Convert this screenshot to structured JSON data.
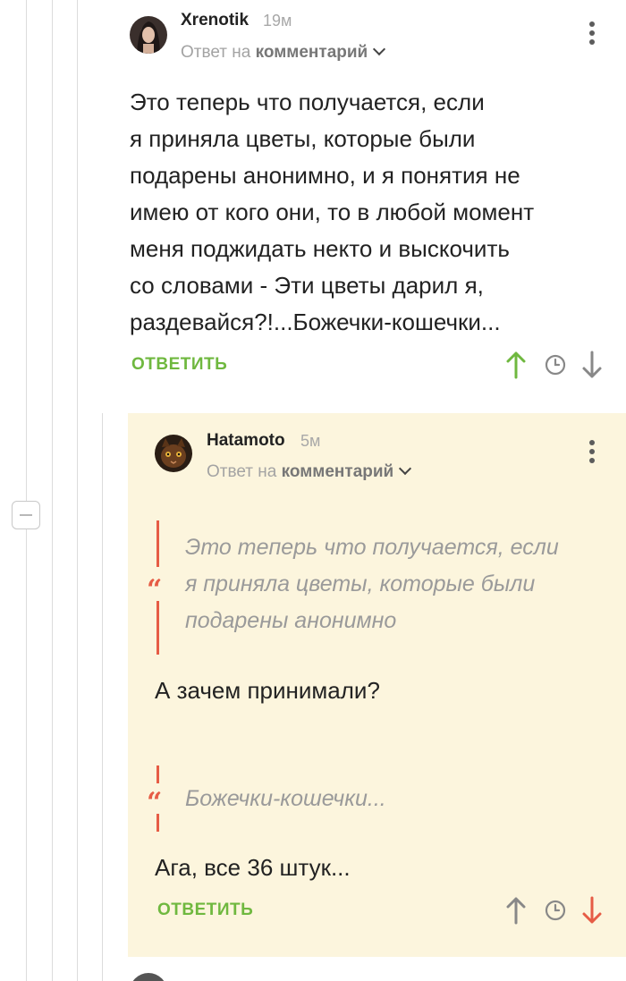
{
  "comment1": {
    "author": "Xrenotik",
    "time": "19м",
    "reply_prefix": "Ответ на",
    "reply_target": "комментарий",
    "text": "Это теперь что получается, если\nя приняла цветы, которые были\nподарены анонимно, и я понятия не\nимею от кого они, то в любой момент\nменя поджидать некто и выскочить\nсо словами  - Эти цветы дарил я,\nраздевайся?!...Божечки-кошечки...",
    "reply_label": "ОТВЕТИТЬ",
    "icons": [
      "upvote-icon",
      "clock-icon",
      "downvote-icon"
    ],
    "vote_state": "up"
  },
  "comment2": {
    "author": "Hatamoto",
    "time": "5м",
    "reply_prefix": "Ответ на",
    "reply_target": "комментарий",
    "quote1": "Это теперь что получается, если\nя приняла цветы, которые были\nподарены анонимно",
    "text1": "А зачем принимали?",
    "quote2": "Божечки-кошечки...",
    "text2": "Ага, все 36 штук...",
    "reply_label": "ОТВЕТИТЬ",
    "icons": [
      "upvote-icon",
      "clock-icon",
      "downvote-icon"
    ],
    "vote_state": "down"
  },
  "colors": {
    "accent_green": "#6fb83f",
    "accent_red": "#e65c45",
    "highlight_bg": "#fcf5dd"
  }
}
